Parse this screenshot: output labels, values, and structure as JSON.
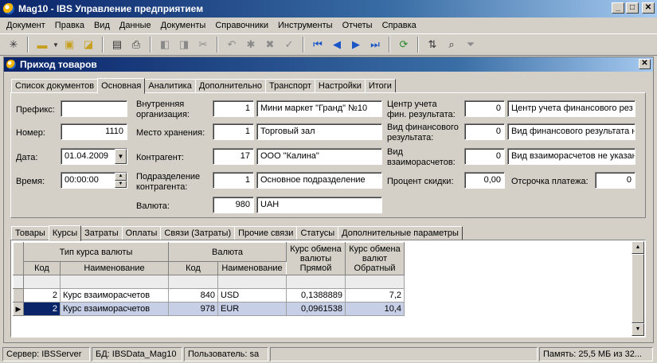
{
  "window": {
    "title": "Mag10 - IBS Управление предприятием"
  },
  "menu": [
    "Документ",
    "Правка",
    "Вид",
    "Данные",
    "Документы",
    "Справочники",
    "Инструменты",
    "Отчеты",
    "Справка"
  ],
  "child": {
    "title": "Приход товаров"
  },
  "top_tabs": [
    "Список документов",
    "Основная",
    "Аналитика",
    "Дополнительно",
    "Транспорт",
    "Настройки",
    "Итоги"
  ],
  "top_tab_active": "Основная",
  "form": {
    "prefix_label": "Префикс:",
    "prefix_value": "",
    "number_label": "Номер:",
    "number_value": "1110",
    "date_label": "Дата:",
    "date_value": "01.04.2009",
    "time_label": "Время:",
    "time_value": "00:00:00",
    "internal_org_label_1": "Внутренняя",
    "internal_org_label_2": "организация:",
    "internal_org_code": "1",
    "internal_org_name": "Мини маркет \"Гранд\" №10",
    "storage_label": "Место хранения:",
    "storage_code": "1",
    "storage_name": "Торговый зал",
    "contractor_label": "Контрагент:",
    "contractor_code": "17",
    "contractor_name": "ООО \"Калина\"",
    "subdiv_label_1": "Подразделение",
    "subdiv_label_2": "контрагента:",
    "subdiv_code": "1",
    "subdiv_name": "Основное подразделение",
    "currency_label": "Валюта:",
    "currency_code": "980",
    "currency_name": "UAH",
    "acc_center_label_1": "Центр учета",
    "acc_center_label_2": "фин. результата:",
    "acc_center_code": "0",
    "acc_center_name": "Центр учета финансового рез",
    "fin_type_label_1": "Вид финансового",
    "fin_type_label_2": "результата:",
    "fin_type_code": "0",
    "fin_type_name": "Вид финансового результата н",
    "settle_type_label_1": "Вид",
    "settle_type_label_2": "взаиморасчетов:",
    "settle_type_code": "0",
    "settle_type_name": "Вид взаиморасчетов не указан",
    "discount_label": "Процент скидки:",
    "discount_value": "0,00",
    "deferral_label": "Отсрочка платежа:",
    "deferral_value": "0"
  },
  "bottom_tabs": [
    "Товары",
    "Курсы",
    "Затраты",
    "Оплаты",
    "Связи (Затраты)",
    "Прочие связи",
    "Статусы",
    "Дополнительные параметры"
  ],
  "bottom_tab_active": "Курсы",
  "grid": {
    "group_rate_type": "Тип курса валюты",
    "group_currency": "Валюта",
    "col_rate_direct_1": "Курс обмена",
    "col_rate_direct_2": "валюты",
    "col_rate_direct_3": "Прямой",
    "col_rate_reverse_1": "Курс обмена",
    "col_rate_reverse_2": "валют",
    "col_rate_reverse_3": "Обратный",
    "col_code": "Код",
    "col_name": "Наименование",
    "rows": [
      {
        "type_code": "2",
        "type_name": "Курс взаиморасчетов",
        "cur_code": "840",
        "cur_name": "USD",
        "direct": "0,1388889",
        "reverse": "7,2"
      },
      {
        "type_code": "2",
        "type_name": "Курс взаиморасчетов",
        "cur_code": "978",
        "cur_name": "EUR",
        "direct": "0,0961538",
        "reverse": "10,4"
      }
    ]
  },
  "status": {
    "server": "Сервер: IBSServer",
    "db": "БД: IBSData_Mag10",
    "user": "Пользователь: sa",
    "memory": "Память: 25,5 МБ из 32..."
  }
}
